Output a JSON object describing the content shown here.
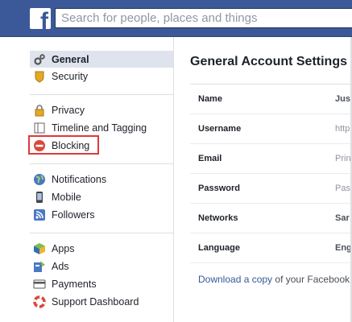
{
  "header": {
    "logo": "f",
    "search_placeholder": "Search for people, places and things"
  },
  "nav": {
    "group1": [
      {
        "label": "General",
        "icon": "gear-icon",
        "selected": true
      },
      {
        "label": "Security",
        "icon": "shield-badge-icon"
      }
    ],
    "group2": [
      {
        "label": "Privacy",
        "icon": "lock-icon"
      },
      {
        "label": "Timeline and Tagging",
        "icon": "timeline-icon"
      },
      {
        "label": "Blocking",
        "icon": "block-icon",
        "highlighted": true
      }
    ],
    "group3": [
      {
        "label": "Notifications",
        "icon": "globe-icon"
      },
      {
        "label": "Mobile",
        "icon": "mobile-phone-icon"
      },
      {
        "label": "Followers",
        "icon": "rss-icon"
      }
    ],
    "group4": [
      {
        "label": "Apps",
        "icon": "apps-cube-icon"
      },
      {
        "label": "Ads",
        "icon": "ads-icon"
      },
      {
        "label": "Payments",
        "icon": "credit-card-icon"
      },
      {
        "label": "Support Dashboard",
        "icon": "life-ring-icon"
      }
    ]
  },
  "main": {
    "title": "General Account Settings",
    "rows": [
      {
        "label": "Name",
        "value": "Jus"
      },
      {
        "label": "Username",
        "value": "http"
      },
      {
        "label": "Email",
        "value": "Prin"
      },
      {
        "label": "Password",
        "value": "Pas"
      },
      {
        "label": "Networks",
        "value": "Sar"
      },
      {
        "label": "Language",
        "value": "Eng"
      }
    ],
    "download_link": "Download a copy",
    "download_text": " of your Facebook"
  },
  "colors": {
    "brand": "#3b5998",
    "highlight": "#e0383b",
    "selected_bg": "#dfe3ee"
  }
}
